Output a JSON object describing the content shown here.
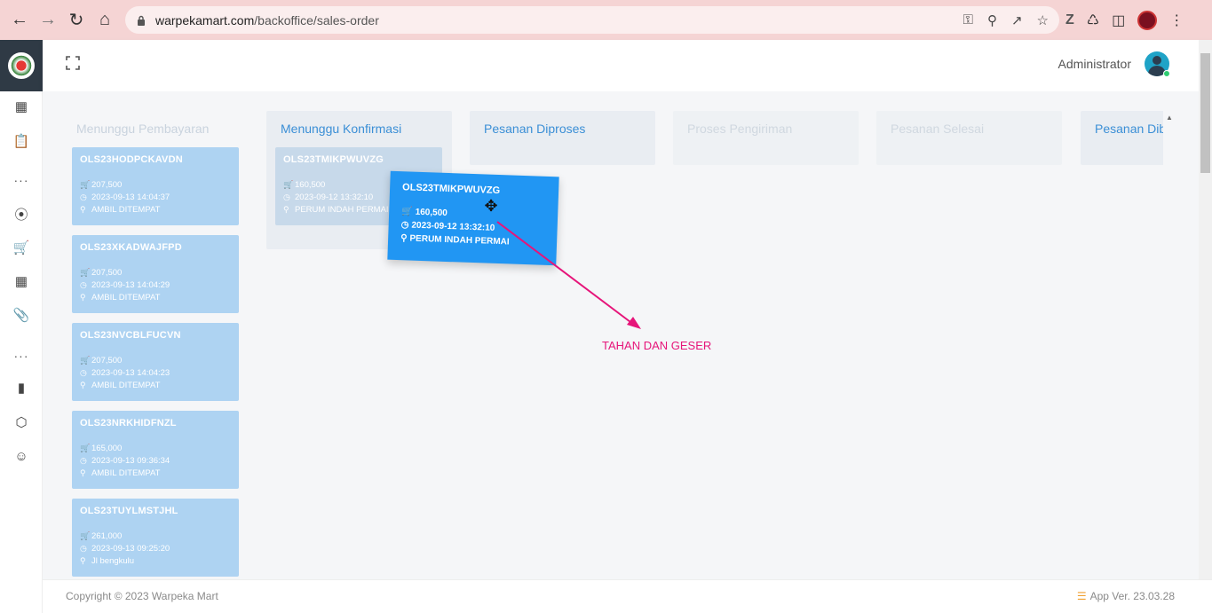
{
  "browser": {
    "url_domain": "warpekamart.com",
    "url_path": "/backoffice/sales-order"
  },
  "header": {
    "user_name": "Administrator"
  },
  "columns": [
    {
      "title": "Menunggu Pembayaran",
      "color": "#c9d3de"
    },
    {
      "title": "Menunggu Konfirmasi",
      "color": "#3b8fd6"
    },
    {
      "title": "Pesanan Diproses",
      "color": "#3b8fd6"
    },
    {
      "title": "Proses Pengiriman",
      "color": "#d0d8e0"
    },
    {
      "title": "Pesanan Selesai",
      "color": "#d0d8e0"
    },
    {
      "title": "Pesanan Dib",
      "color": "#3b8fd6"
    }
  ],
  "cards_payment": [
    {
      "code": "OLS23HODPCKAVDN",
      "total": "207,500",
      "date": "2023-09-13 14:04:37",
      "address": "AMBIL DITEMPAT"
    },
    {
      "code": "OLS23XKADWAJFPD",
      "total": "207,500",
      "date": "2023-09-13 14:04:29",
      "address": "AMBIL DITEMPAT"
    },
    {
      "code": "OLS23NVCBLFUCVN",
      "total": "207,500",
      "date": "2023-09-13 14:04:23",
      "address": "AMBIL DITEMPAT"
    },
    {
      "code": "OLS23NRKHIDFNZL",
      "total": "165,000",
      "date": "2023-09-13 09:36:34",
      "address": "AMBIL DITEMPAT"
    },
    {
      "code": "OLS23TUYLMSTJHL",
      "total": "261,000",
      "date": "2023-09-13 09:25:20",
      "address": "Jl bengkulu"
    }
  ],
  "card_confirm_ghost": {
    "code": "OLS23TMIKPWUVZG",
    "total": "160,500",
    "date": "2023-09-12 13:32:10",
    "address": "PERUM INDAH PERMAI"
  },
  "card_dragged": {
    "code": "OLS23TMIKPWUVZG",
    "total": "160,500",
    "date": "2023-09-12 13:32:10",
    "address": "PERUM INDAH PERMAI"
  },
  "annotation": {
    "text": "TAHAN DAN GESER",
    "color": "#e6157a"
  },
  "footer": {
    "copyright": "Copyright © 2023 Warpeka Mart",
    "version": "App Ver. 23.03.28"
  }
}
